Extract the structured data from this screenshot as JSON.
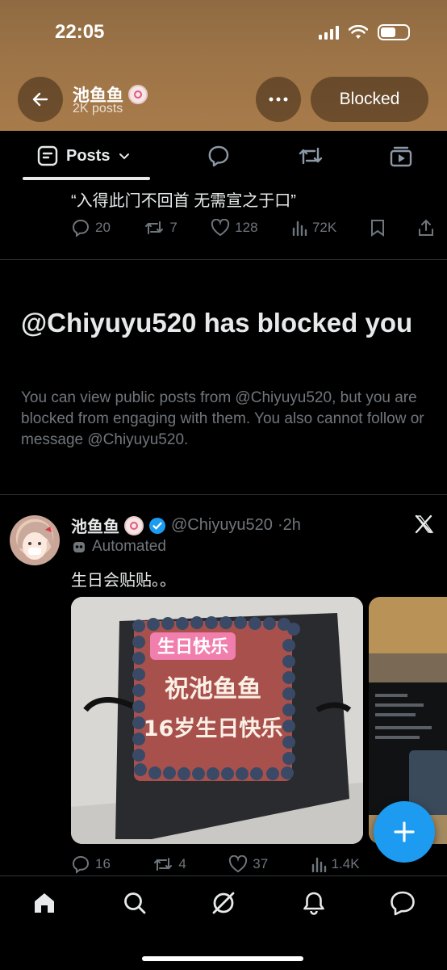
{
  "status_bar": {
    "time": "22:05"
  },
  "header": {
    "profile_name": "池鱼鱼",
    "posts_count": "2K posts",
    "blocked_label": "Blocked"
  },
  "tabs": {
    "posts_label": "Posts"
  },
  "pinned_post": {
    "text": "“入得此门不回首 无需宣之于口”",
    "replies": "20",
    "reposts": "7",
    "likes": "128",
    "views": "72K"
  },
  "blocked_notice": {
    "title": "@Chiyuyu520 has blocked you",
    "description": "You can view public posts from @Chiyuyu520, but you are blocked from engaging with them. You also cannot follow or message @Chiyuyu520."
  },
  "tweet": {
    "name": "池鱼鱼",
    "handle": "@Chiyuyu520",
    "time": "·2h",
    "automated_label": "Automated",
    "text": "生日会贴贴。。",
    "cake_top_text": "生日快乐",
    "cake_line1": "祝池鱼鱼",
    "cake_line2": "16岁生日快乐",
    "replies": "16",
    "reposts": "4",
    "likes": "37",
    "views": "1.4K"
  },
  "colors": {
    "accent": "#1d9bf0",
    "header_bg": "#9d7447",
    "muted": "#71767b"
  }
}
